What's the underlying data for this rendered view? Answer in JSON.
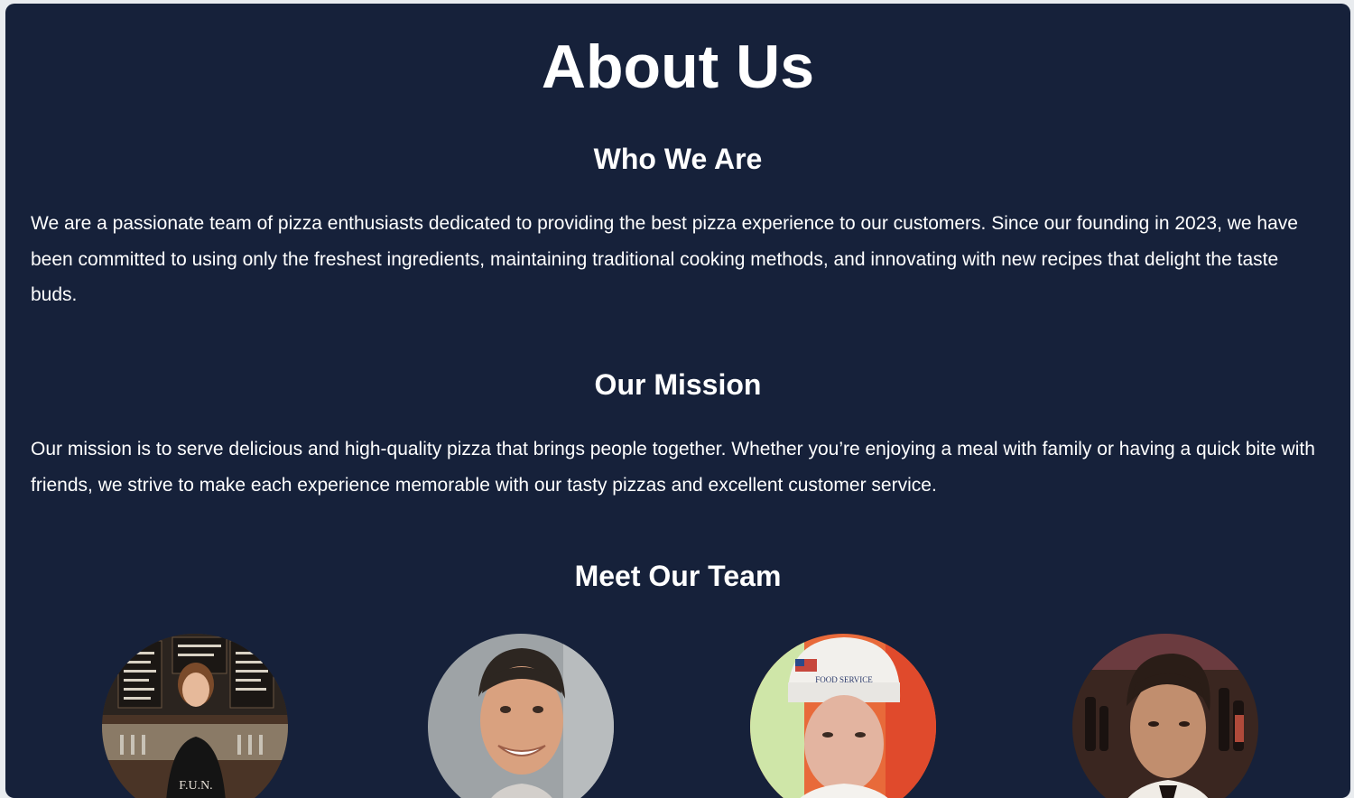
{
  "page": {
    "title": "About Us"
  },
  "who_we_are": {
    "heading": "Who We Are",
    "text": "We are a passionate team of pizza enthusiasts dedicated to providing the best pizza experience to our customers. Since our founding in 2023, we have been committed to using only the freshest ingredients, maintaining traditional cooking methods, and innovating with new recipes that delight the taste buds."
  },
  "mission": {
    "heading": "Our Mission",
    "text": "Our mission is to serve delicious and high-quality pizza that brings people together. Whether you’re enjoying a meal with family or having a quick bite with friends, we strive to make each experience memorable with our tasty pizzas and excellent customer service."
  },
  "team": {
    "heading": "Meet Our Team",
    "members": [
      {
        "photo": "team-photo-1"
      },
      {
        "photo": "team-photo-2"
      },
      {
        "photo": "team-photo-3"
      },
      {
        "photo": "team-photo-4"
      }
    ]
  },
  "colors": {
    "background": "#16213a",
    "text": "#ffffff",
    "page_bg": "#e9ecef"
  }
}
